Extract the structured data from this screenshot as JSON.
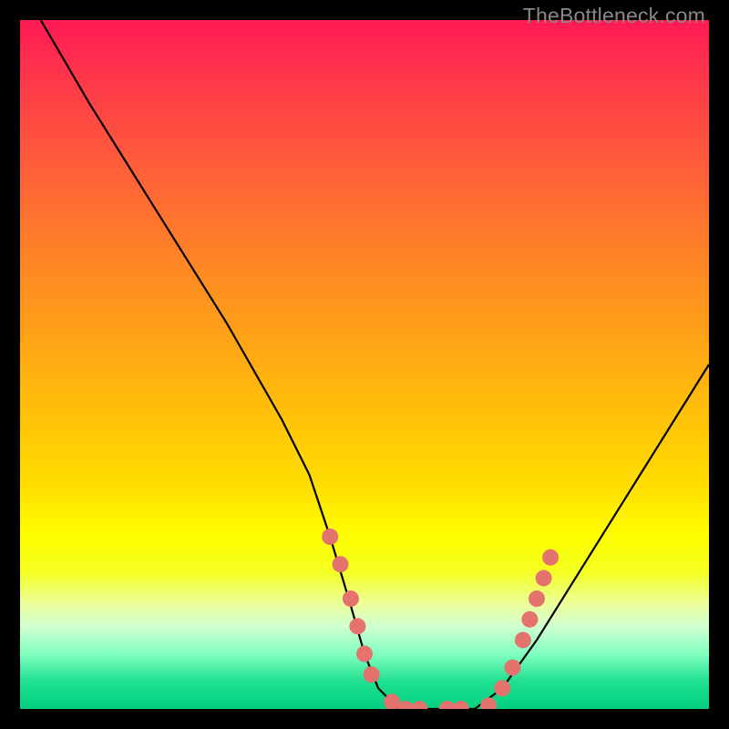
{
  "watermark": "TheBottleneck.com",
  "chart_data": {
    "type": "line",
    "title": "",
    "xlabel": "",
    "ylabel": "",
    "xlim": [
      0,
      100
    ],
    "ylim": [
      0,
      100
    ],
    "series": [
      {
        "name": "bottleneck-curve",
        "x": [
          3,
          10,
          20,
          30,
          38,
          42,
          45,
          48,
          50,
          52,
          55,
          58,
          62,
          66,
          70,
          75,
          80,
          85,
          90,
          95,
          100
        ],
        "y": [
          100,
          88,
          72,
          56,
          42,
          34,
          25,
          15,
          8,
          3,
          0,
          0,
          0,
          0,
          3,
          10,
          18,
          26,
          34,
          42,
          50
        ]
      }
    ],
    "markers": {
      "name": "highlighted-points",
      "color": "#e4736d",
      "points": [
        {
          "x": 45,
          "y": 25
        },
        {
          "x": 46.5,
          "y": 21
        },
        {
          "x": 48,
          "y": 16
        },
        {
          "x": 49,
          "y": 12
        },
        {
          "x": 50,
          "y": 8
        },
        {
          "x": 51,
          "y": 5
        },
        {
          "x": 54,
          "y": 1
        },
        {
          "x": 56,
          "y": 0
        },
        {
          "x": 58,
          "y": 0
        },
        {
          "x": 62,
          "y": 0
        },
        {
          "x": 64,
          "y": 0
        },
        {
          "x": 68,
          "y": 0.5
        },
        {
          "x": 70,
          "y": 3
        },
        {
          "x": 71.5,
          "y": 6
        },
        {
          "x": 73,
          "y": 10
        },
        {
          "x": 74,
          "y": 13
        },
        {
          "x": 75,
          "y": 16
        },
        {
          "x": 76,
          "y": 19
        },
        {
          "x": 77,
          "y": 22
        }
      ]
    },
    "gradient_stops": [
      {
        "pos": 0,
        "color": "#ff1a52"
      },
      {
        "pos": 25,
        "color": "#ff7028"
      },
      {
        "pos": 50,
        "color": "#ffc008"
      },
      {
        "pos": 75,
        "color": "#ffff00"
      },
      {
        "pos": 100,
        "color": "#00d080"
      }
    ]
  }
}
